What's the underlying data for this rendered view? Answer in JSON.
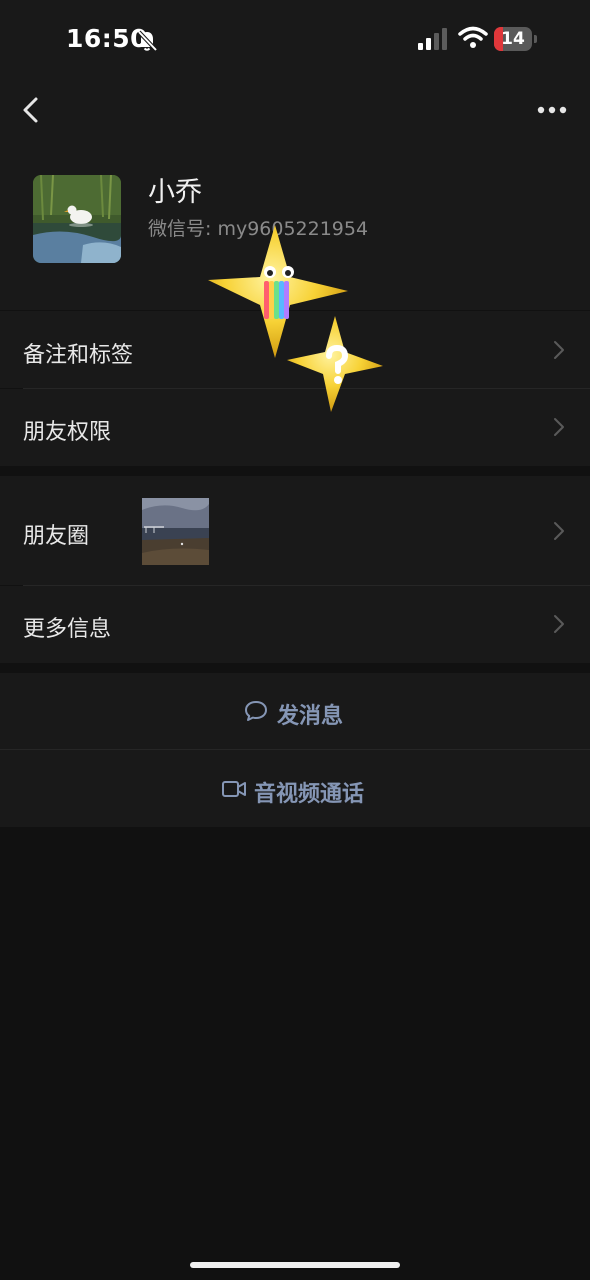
{
  "status": {
    "time": "16:50",
    "battery": "14",
    "icons": [
      "bell-slash-icon",
      "signal-icon",
      "wifi-icon",
      "battery-icon"
    ]
  },
  "nav": {
    "icons": [
      "back-chevron-icon",
      "more-dots-icon"
    ]
  },
  "profile": {
    "name": "小乔",
    "wechat_id": "微信号: my9605221954"
  },
  "rows": {
    "notes_tags": "备注和标签",
    "friend_permissions": "朋友权限",
    "moments": "朋友圈",
    "more_info": "更多信息"
  },
  "actions": {
    "send_message": "发消息",
    "video_call": "音视频通话"
  },
  "colors": {
    "background": "#111111",
    "card": "#191919",
    "action_text": "#8596b5",
    "battery_low": "#e0373a"
  }
}
